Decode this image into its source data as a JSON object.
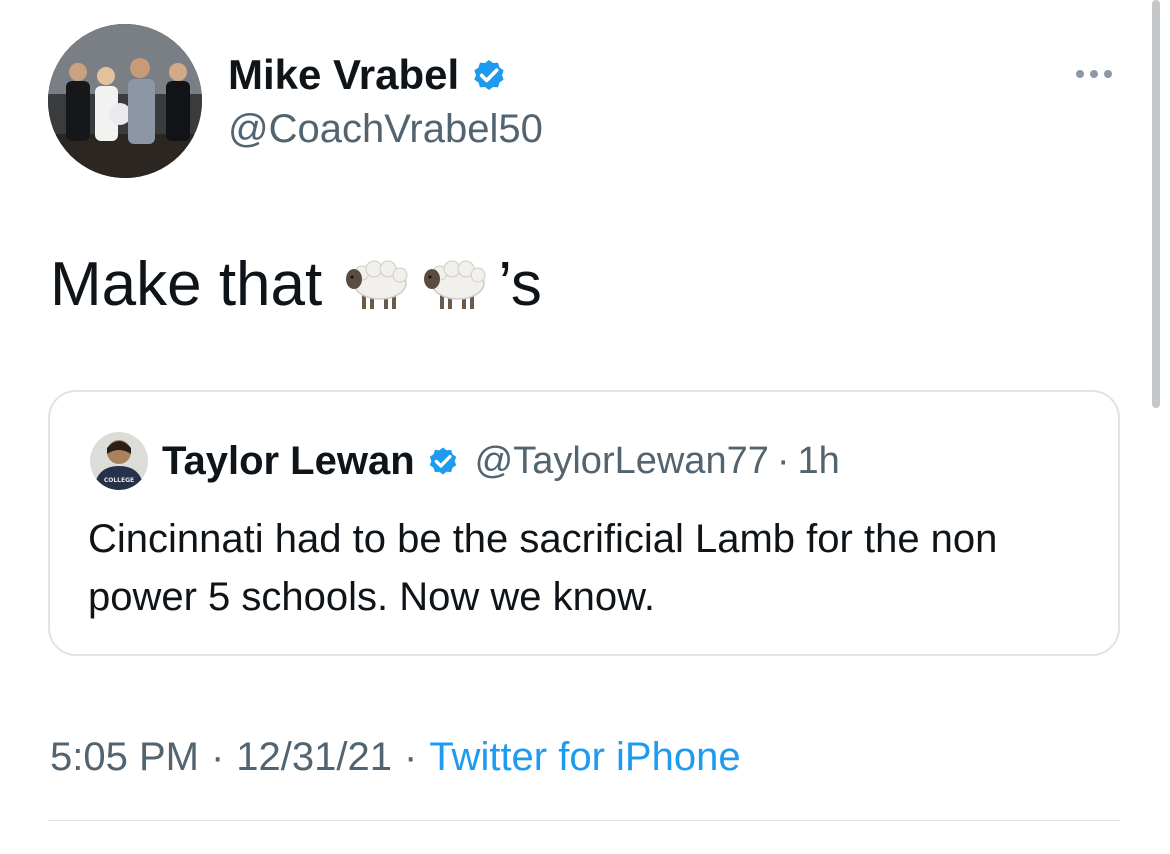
{
  "tweet": {
    "author": {
      "name": "Mike Vrabel",
      "handle": "@CoachVrabel50",
      "verified": true,
      "avatar": "family-photo-avatar"
    },
    "text": "Make that",
    "emoji": [
      "sheep",
      "sheep"
    ],
    "text_suffix": "’s",
    "timestamp": "5:05 PM",
    "date": "12/31/21",
    "source": "Twitter for iPhone",
    "separator": "·"
  },
  "quoted_tweet": {
    "author": {
      "name": "Taylor Lewan",
      "handle": "@TaylorLewan77",
      "verified": true,
      "avatar": "college-shirt-avatar",
      "avatar_text": "COLLEGE"
    },
    "separator": "·",
    "time": "1h",
    "text": "Cincinnati had to be the sacrificial Lamb for the non power 5 schools. Now we know."
  },
  "colors": {
    "verified_blue": "#1d9bf0",
    "secondary_text": "#536471",
    "border": "#dfe3e7"
  }
}
